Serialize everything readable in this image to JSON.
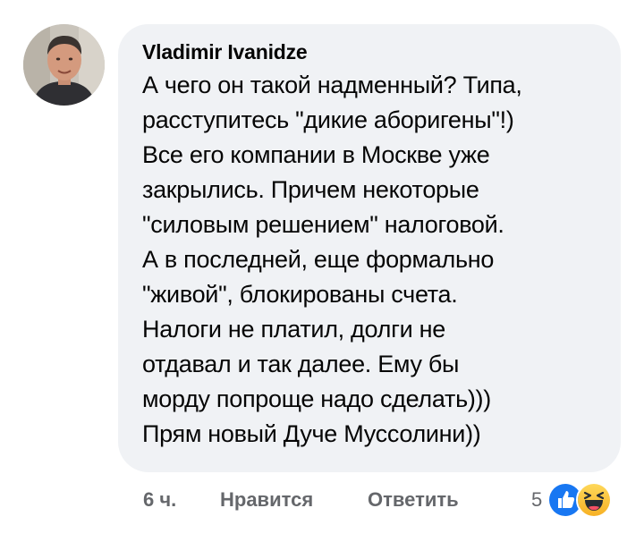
{
  "comment": {
    "author": "Vladimir Ivanidze",
    "lines": [
      "А чего он такой надменный? Типа,",
      "расступитесь \"дикие аборигены\"!)",
      "Все его компании в Москве уже",
      "закрылись. Причем некоторые",
      "\"силовым решением\" налоговой.",
      "А в последней, еще формально",
      "\"живой\", блокированы счета.",
      "Налоги не платил, долги не",
      "отдавал и так далее. Ему бы",
      "морду попроще надо сделать)))",
      "Прям новый Дуче Муссолини))"
    ]
  },
  "actions": {
    "time": "6 ч.",
    "like_label": "Нравится",
    "reply_label": "Ответить",
    "reaction_count": "5",
    "reaction_icons": [
      "like-icon",
      "haha-icon"
    ]
  },
  "colors": {
    "bubble": "#f0f2f5",
    "text": "#050505",
    "secondary": "#65676b",
    "like": "#1877f2",
    "haha": "#f7b125"
  }
}
